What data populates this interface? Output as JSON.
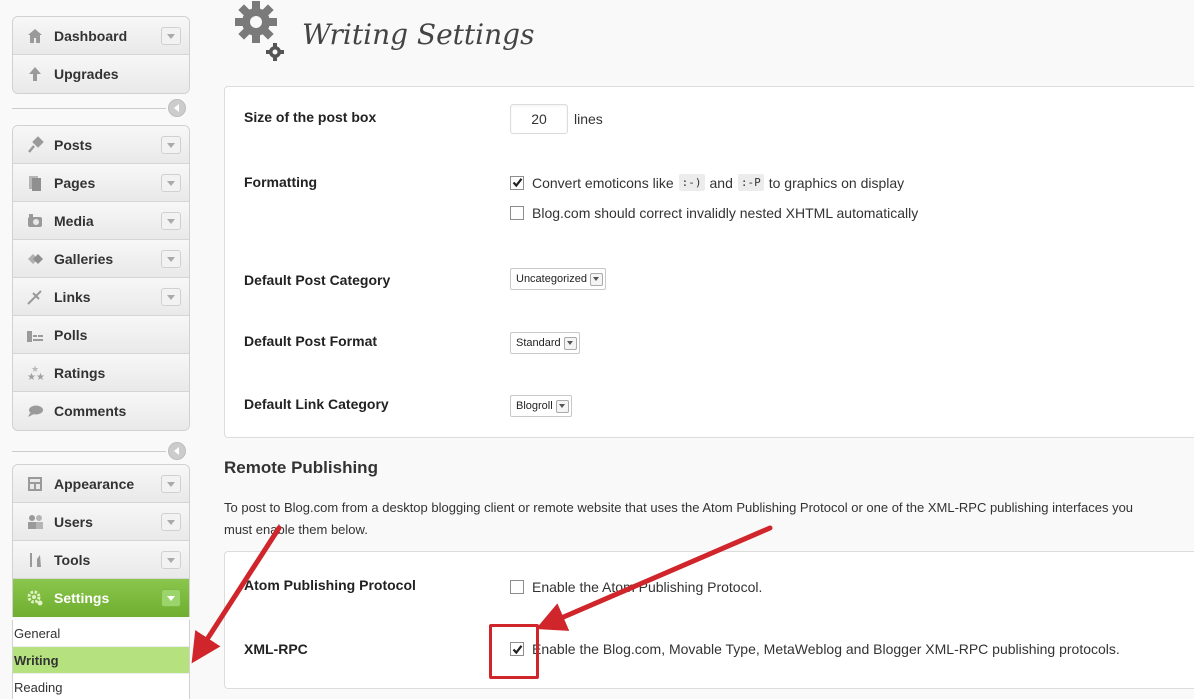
{
  "sidebar": {
    "group1": [
      {
        "label": "Dashboard",
        "icon": "house-icon",
        "has_arrow": true
      },
      {
        "label": "Upgrades",
        "icon": "upgrade-arrow-icon",
        "has_arrow": false
      }
    ],
    "group2": [
      {
        "label": "Posts",
        "icon": "pin-icon",
        "has_arrow": true
      },
      {
        "label": "Pages",
        "icon": "pages-icon",
        "has_arrow": true
      },
      {
        "label": "Media",
        "icon": "media-icon",
        "has_arrow": true
      },
      {
        "label": "Galleries",
        "icon": "galleries-icon",
        "has_arrow": true
      },
      {
        "label": "Links",
        "icon": "links-icon",
        "has_arrow": true
      },
      {
        "label": "Polls",
        "icon": "polls-icon",
        "has_arrow": false
      },
      {
        "label": "Ratings",
        "icon": "ratings-icon",
        "has_arrow": false
      },
      {
        "label": "Comments",
        "icon": "comments-icon",
        "has_arrow": false
      }
    ],
    "group3": [
      {
        "label": "Appearance",
        "icon": "appearance-icon",
        "has_arrow": true
      },
      {
        "label": "Users",
        "icon": "users-icon",
        "has_arrow": true
      },
      {
        "label": "Tools",
        "icon": "tools-icon",
        "has_arrow": true
      },
      {
        "label": "Settings",
        "icon": "gear-icon",
        "has_arrow": true,
        "active": true
      }
    ],
    "settings_submenu": [
      {
        "label": "General",
        "current": false
      },
      {
        "label": "Writing",
        "current": true
      },
      {
        "label": "Reading",
        "current": false
      }
    ]
  },
  "page": {
    "title": "Writing Settings",
    "icon": "gears-icon"
  },
  "writing": {
    "post_box": {
      "label": "Size of the post box",
      "value": "20",
      "unit": "lines"
    },
    "formatting": {
      "label": "Formatting",
      "emoticons": {
        "checked": true,
        "text_before": "Convert emoticons like",
        "code1": ":-)",
        "text_mid": "and",
        "code2": ":-P",
        "text_after": "to graphics on display"
      },
      "xhtml": {
        "checked": false,
        "text": "Blog.com should correct invalidly nested XHTML automatically"
      }
    },
    "default_category": {
      "label": "Default Post Category",
      "selected": "Uncategorized"
    },
    "default_format": {
      "label": "Default Post Format",
      "selected": "Standard"
    },
    "default_link_category": {
      "label": "Default Link Category",
      "selected": "Blogroll"
    }
  },
  "remote": {
    "heading": "Remote Publishing",
    "description": "To post to Blog.com from a desktop blogging client or remote website that uses the Atom Publishing Protocol or one of the XML-RPC publishing interfaces you must enable them below.",
    "atom": {
      "label": "Atom Publishing Protocol",
      "checked": false,
      "text": "Enable the Atom Publishing Protocol."
    },
    "xmlrpc": {
      "label": "XML-RPC",
      "checked": true,
      "text": "Enable the Blog.com, Movable Type, MetaWeblog and Blogger XML-RPC publishing protocols."
    }
  },
  "colors": {
    "active_menu": "#7ab83b",
    "current_submenu": "#b5e27e",
    "annotation_red": "#d0252a"
  }
}
